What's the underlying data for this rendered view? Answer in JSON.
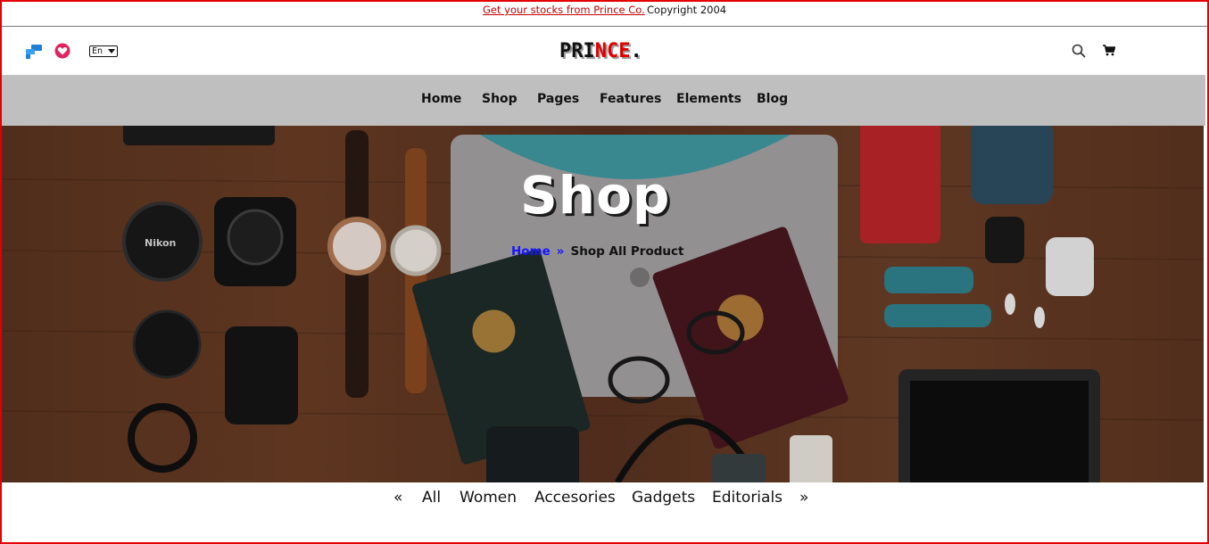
{
  "topbar": {
    "promo_link": "Get your stocks from Prince Co.",
    "copyright": "Copyright 2004"
  },
  "header": {
    "logo_part1": "PRI",
    "logo_part2": "NCE",
    "logo_dot": ".",
    "language": "En",
    "icons": [
      "share-icon",
      "heart-icon",
      "search-icon",
      "cart-icon"
    ]
  },
  "nav": {
    "items": [
      "Home",
      "Shop",
      "Pages",
      "Features",
      "Elements",
      "Blog"
    ]
  },
  "hero": {
    "title": "Shop",
    "breadcrumb": {
      "home": "Home",
      "separator": "»",
      "current": "Shop All Product"
    },
    "background": "flat-lay photo: cameras, watches, laptop, passports, glasses, phone, tablet on wood table"
  },
  "category_tabs": {
    "prev": "«",
    "items": [
      "All",
      "Women",
      "Accesories",
      "Gadgets",
      "Editorials"
    ],
    "next": "»"
  },
  "colors": {
    "border": "#e30000",
    "nav_bg": "#bfbfbf",
    "link_red": "#c40000",
    "breadcrumb_blue": "#1515ff"
  }
}
